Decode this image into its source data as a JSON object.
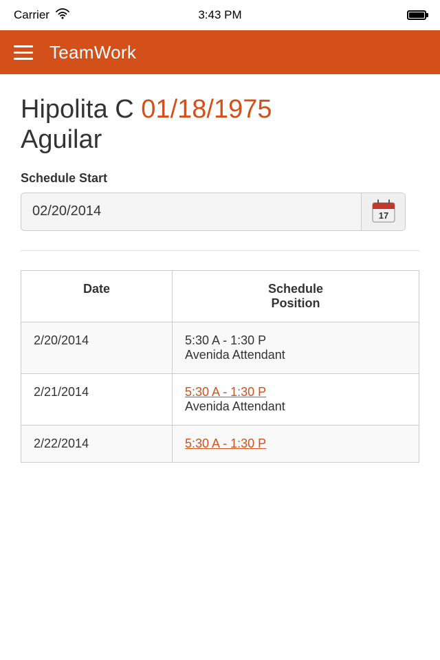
{
  "status_bar": {
    "carrier": "Carrier",
    "time": "3:43 PM"
  },
  "navbar": {
    "title": "TeamWork"
  },
  "person": {
    "first_name": "Hipolita C",
    "dob": "01/18/1975",
    "last_name": "Aguilar"
  },
  "schedule_start": {
    "label": "Schedule Start",
    "date_value": "02/20/2014",
    "calendar_day": "17"
  },
  "table": {
    "col_date": "Date",
    "col_schedule_position": "Schedule Position",
    "rows": [
      {
        "date": "2/20/2014",
        "time": "5:30 A - 1:30 P",
        "position": "Avenida Attendant",
        "time_link": false
      },
      {
        "date": "2/21/2014",
        "time": "5:30 A - 1:30 P",
        "position": "Avenida Attendant",
        "time_link": true
      },
      {
        "date": "2/22/2014",
        "time": "5:30 A - 1:30 P",
        "position": "",
        "time_link": true
      }
    ]
  }
}
